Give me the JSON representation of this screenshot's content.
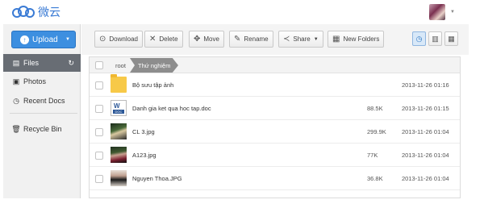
{
  "app": {
    "brand": "微云"
  },
  "sidebar": {
    "upload_label": "Upload",
    "items": [
      {
        "label": "Files",
        "icon": "files-icon",
        "active": true
      },
      {
        "label": "Photos",
        "icon": "photos-icon"
      },
      {
        "label": "Recent Docs",
        "icon": "clock-icon"
      },
      {
        "label": "Recycle Bin",
        "icon": "trash-icon"
      }
    ]
  },
  "toolbar": {
    "download": "Download",
    "delete": "Delete",
    "move": "Move",
    "rename": "Rename",
    "share": "Share",
    "new_folders": "New Folders"
  },
  "breadcrumb": {
    "root": "root",
    "current": "Thứ nghiệm"
  },
  "files": [
    {
      "name": "Bộ sưu tập ảnh",
      "size": "",
      "date": "2013-11-26 01:16",
      "type": "folder"
    },
    {
      "name": "Danh gia ket qua hoc tap.doc",
      "size": "88.5K",
      "date": "2013-11-26 01:15",
      "type": "doc",
      "doc_badge": "DOC"
    },
    {
      "name": "CL 3.jpg",
      "size": "299.9K",
      "date": "2013-11-26 01:04",
      "type": "image"
    },
    {
      "name": "A123.jpg",
      "size": "77K",
      "date": "2013-11-26 01:04",
      "type": "image"
    },
    {
      "name": "Nguyen Thoa.JPG",
      "size": "36.8K",
      "date": "2013-11-26 01:04",
      "type": "image"
    }
  ],
  "colors": {
    "accent": "#3d8fe0",
    "active_nav": "#686d74",
    "folder": "#f7c948"
  }
}
